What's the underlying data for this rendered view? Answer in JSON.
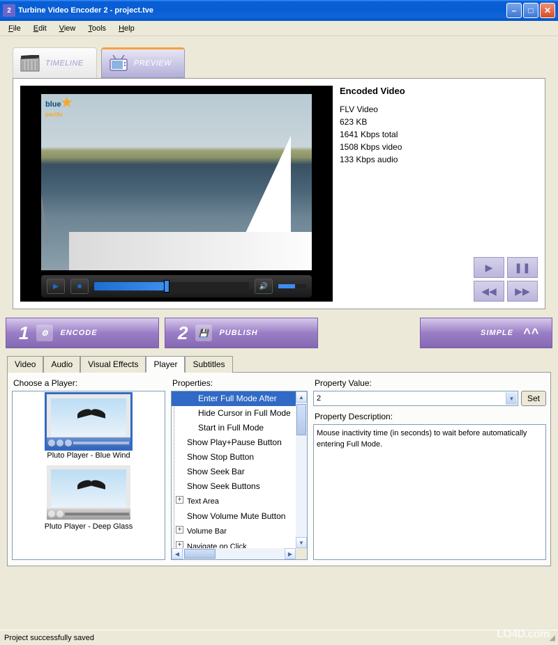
{
  "titlebar": {
    "text": "Turbine Video Encoder 2 - project.tve"
  },
  "menu": {
    "file": "File",
    "edit": "Edit",
    "view": "View",
    "tools": "Tools",
    "help": "Help"
  },
  "main_tabs": {
    "timeline": "TIMELINE",
    "preview": "PREVIEW"
  },
  "video_logo": {
    "line1": "blue",
    "line2": "pacific"
  },
  "info": {
    "title": "Encoded Video",
    "format": "FLV Video",
    "size": "623 KB",
    "total": "1641 Kbps total",
    "video": "1508 Kbps video",
    "audio": "133 Kbps audio"
  },
  "steps": {
    "encode": "ENCODE",
    "publish": "PUBLISH",
    "simple": "SIMPLE",
    "n1": "1",
    "n2": "2"
  },
  "subtabs": {
    "video": "Video",
    "audio": "Audio",
    "vfx": "Visual Effects",
    "player": "Player",
    "subtitles": "Subtitles"
  },
  "players": {
    "label": "Choose a Player:",
    "item1": "Pluto Player - Blue Wind",
    "item2": "Pluto Player - Deep Glass"
  },
  "props": {
    "label": "Properties:",
    "items": [
      "Enter Full Mode After",
      "Hide Cursor in Full Mode",
      "Start in Full Mode",
      "Show Play+Pause Button",
      "Show Stop Button",
      "Show Seek Bar",
      "Show Seek Buttons",
      "Text Area",
      "Show Volume Mute Button",
      "Volume Bar",
      "Navigate on Click"
    ]
  },
  "value": {
    "label": "Property Value:",
    "val": "2",
    "set": "Set"
  },
  "desc": {
    "label": "Property Description:",
    "text": "Mouse inactivity time (in seconds) to wait before automatically entering Full Mode."
  },
  "status": "Project successfully saved",
  "watermark": "LO4D.com"
}
